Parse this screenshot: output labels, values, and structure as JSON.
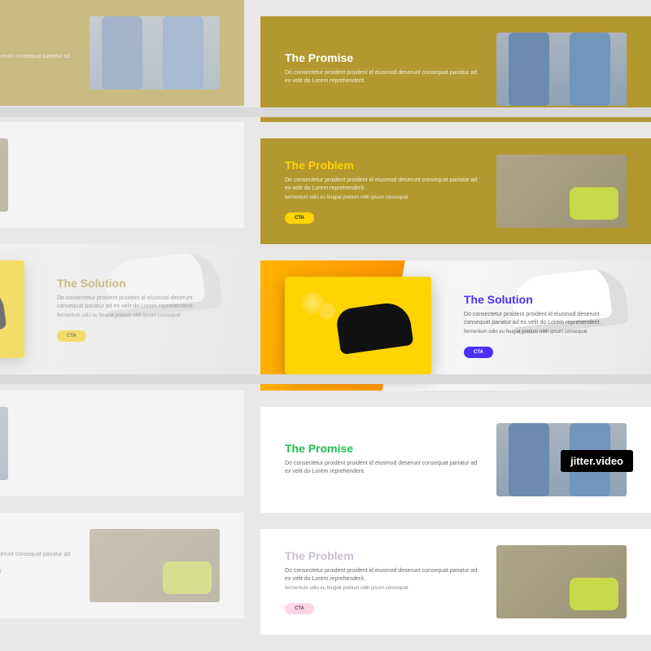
{
  "watermark": "jitter.video",
  "lorem": {
    "body": "Do consectetur proident proident id eiusmod deserunt consequat pariatur ad ex velit do Lorem reprehenderit.",
    "sub": "fermentum odio eu feugiat pretium nibh ipsum consequat"
  },
  "cta_label": "CTA",
  "sections": {
    "promise": {
      "title": "The Promise"
    },
    "problem": {
      "title": "The Problem"
    },
    "solution": {
      "title": "The Solution"
    }
  }
}
